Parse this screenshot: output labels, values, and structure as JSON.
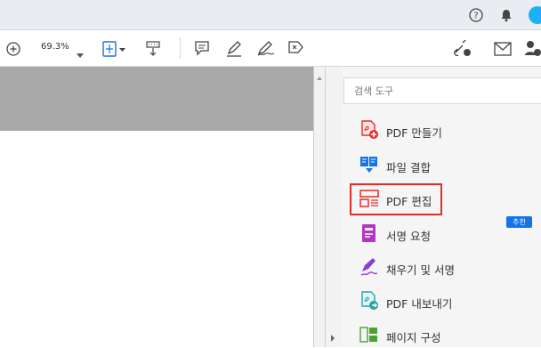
{
  "zoom": {
    "value": "69.3%"
  },
  "search": {
    "placeholder": "검색 도구"
  },
  "tools": [
    {
      "label": "PDF 만들기",
      "icon": "create-pdf-icon"
    },
    {
      "label": "파일 결합",
      "icon": "combine-files-icon"
    },
    {
      "label": "PDF 편집",
      "icon": "edit-pdf-icon"
    },
    {
      "label": "서명 요청",
      "icon": "request-signature-icon"
    },
    {
      "label": "채우기 및 서명",
      "icon": "fill-sign-icon"
    },
    {
      "label": "PDF 내보내기",
      "icon": "export-pdf-icon"
    },
    {
      "label": "페이지 구성",
      "icon": "organize-pages-icon"
    }
  ],
  "badge": {
    "label": "추천"
  },
  "colors": {
    "accent": "#1473e6",
    "highlight": "#e0302c",
    "create": "#e0302c",
    "combine": "#1473e6",
    "edit": "#e0302c",
    "request": "#b634c5",
    "fill": "#8a3fd1",
    "export": "#26a4a4",
    "organize": "#49a331"
  }
}
